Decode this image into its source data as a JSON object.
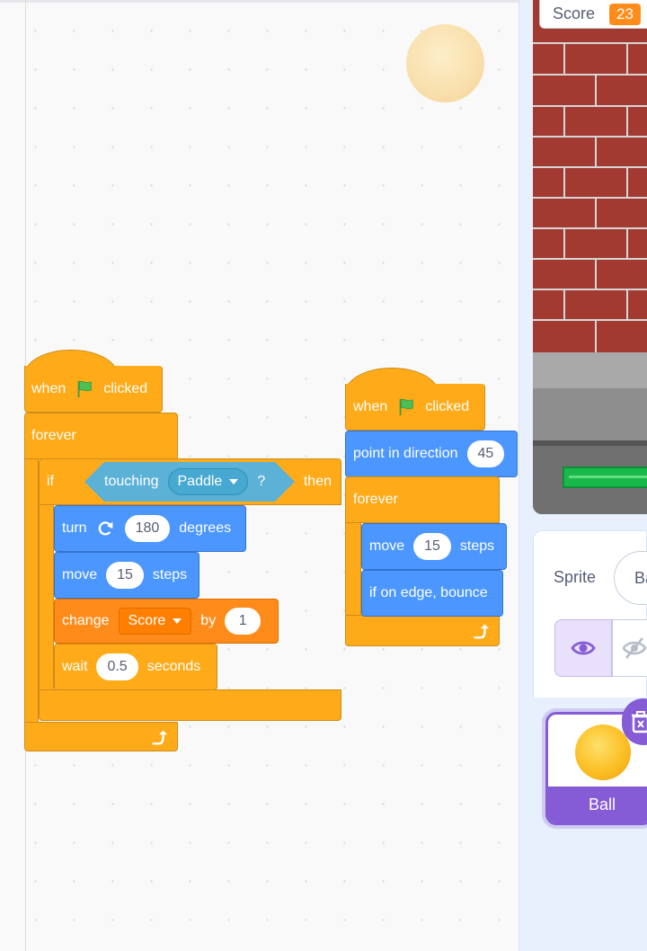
{
  "workspace": {
    "script1": {
      "hat": {
        "when": "when",
        "flag_icon": "green-flag-icon",
        "clicked": "clicked"
      },
      "forever": "forever",
      "if": {
        "if": "if",
        "then": "then",
        "touching": "touching",
        "touching_target": "Paddle",
        "question": "?"
      },
      "turn": {
        "label": "turn",
        "icon": "rotate-right-icon",
        "value": "180",
        "unit": "degrees"
      },
      "move": {
        "label": "move",
        "value": "15",
        "unit": "steps"
      },
      "change": {
        "label": "change",
        "variable": "Score",
        "by": "by",
        "value": "1"
      },
      "wait": {
        "label": "wait",
        "value": "0.5",
        "unit": "seconds"
      },
      "loop_icon": "loop-arrow-icon"
    },
    "script2": {
      "hat": {
        "when": "when",
        "flag_icon": "green-flag-icon",
        "clicked": "clicked"
      },
      "point": {
        "label": "point in direction",
        "value": "45"
      },
      "forever": "forever",
      "move": {
        "label": "move",
        "value": "15",
        "unit": "steps"
      },
      "bounce": "if on edge, bounce",
      "loop_icon": "loop-arrow-icon"
    }
  },
  "stage": {
    "monitor_label": "Score",
    "monitor_value": "23"
  },
  "sprite_info": {
    "sprite_label": "Sprite",
    "sprite_name": "Ball",
    "show_icon": "eye-icon",
    "hide_icon": "eye-slash-icon"
  },
  "sprite_list": {
    "items": [
      {
        "name": "Ball"
      }
    ],
    "delete_icon": "trash-icon"
  },
  "colors": {
    "events": "#ffab19",
    "motion": "#4c97ff",
    "variables": "#ff8c1a",
    "sensing": "#5cb1d6",
    "selected": "#855cd6"
  }
}
